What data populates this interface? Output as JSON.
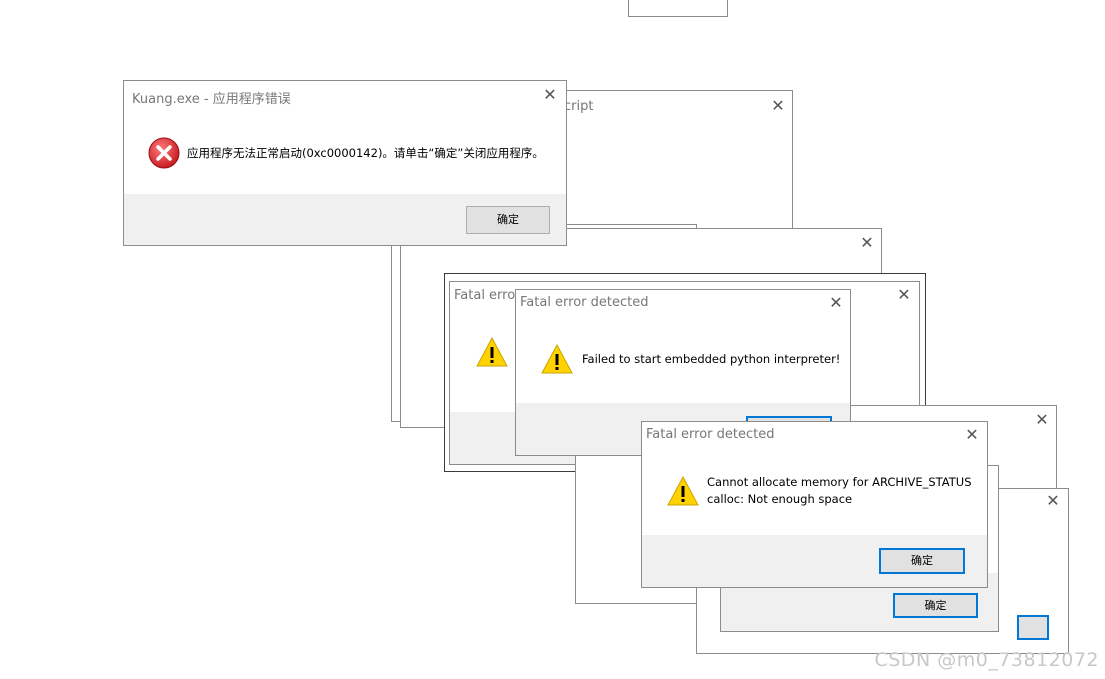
{
  "kuang": {
    "title": "Kuang.exe - 应用程序错误",
    "message": "应用程序无法正常启动(0xc0000142)。请单击“确定”关闭应用程序。",
    "ok_label": "确定"
  },
  "back_script": {
    "title_fragment": "cript"
  },
  "fatal_behind": {
    "title": "Fatal error"
  },
  "fatal_python": {
    "title": "Fatal error detected",
    "message": "Failed to start embedded python interpreter!"
  },
  "fatal_memory": {
    "title": "Fatal error detected",
    "message_line1": "Cannot allocate memory for ARCHIVE_STATUS",
    "message_line2": "calloc: Not enough space",
    "ok_label": "确定"
  },
  "lower_dialog": {
    "ok_label": "确定"
  },
  "watermark": "CSDN @m0_73812072",
  "icons": {
    "error": "error-icon",
    "warning": "warning-icon",
    "close": "close-icon"
  },
  "colors": {
    "focus_border": "#0078d7",
    "footer": "#f0f0f0",
    "error_red": "#d9262b",
    "warning_yellow": "#ffd200"
  }
}
